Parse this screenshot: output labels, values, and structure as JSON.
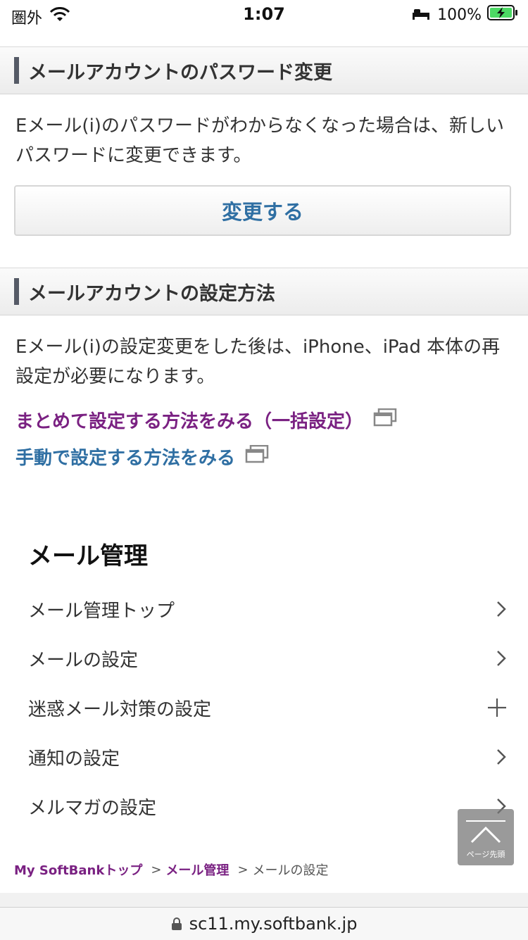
{
  "status_bar": {
    "carrier": "圏外",
    "time": "1:07",
    "battery": "100%"
  },
  "password_section": {
    "title": "メールアカウントのパスワード変更",
    "description": "Eメール(i)のパスワードがわからなくなった場合は、新しいパスワードに変更できます。",
    "button_label": "変更する"
  },
  "settings_section": {
    "title": "メールアカウントの設定方法",
    "description": "Eメール(i)の設定変更をした後は、iPhone、iPad 本体の再設定が必要になります。",
    "link_bulk": "まとめて設定する方法をみる（一括設定）",
    "link_manual": "手動で設定する方法をみる"
  },
  "mail_management": {
    "title": "メール管理",
    "items": [
      {
        "label": "メール管理トップ",
        "icon": "chevron-right"
      },
      {
        "label": "メールの設定",
        "icon": "chevron-right"
      },
      {
        "label": "迷惑メール対策の設定",
        "icon": "plus"
      },
      {
        "label": "通知の設定",
        "icon": "chevron-right"
      },
      {
        "label": "メルマガの設定",
        "icon": "chevron-right"
      }
    ]
  },
  "breadcrumb": {
    "items": [
      "My SoftBankトップ",
      "メール管理",
      "メールの設定"
    ],
    "separator": ">"
  },
  "page_top": {
    "label": "ページ先頭"
  },
  "url_bar": {
    "url": "sc11.my.softbank.jp"
  },
  "colors": {
    "link_purple": "#7a2182",
    "link_blue": "#2f6fa3",
    "section_bar": "#555a66"
  }
}
